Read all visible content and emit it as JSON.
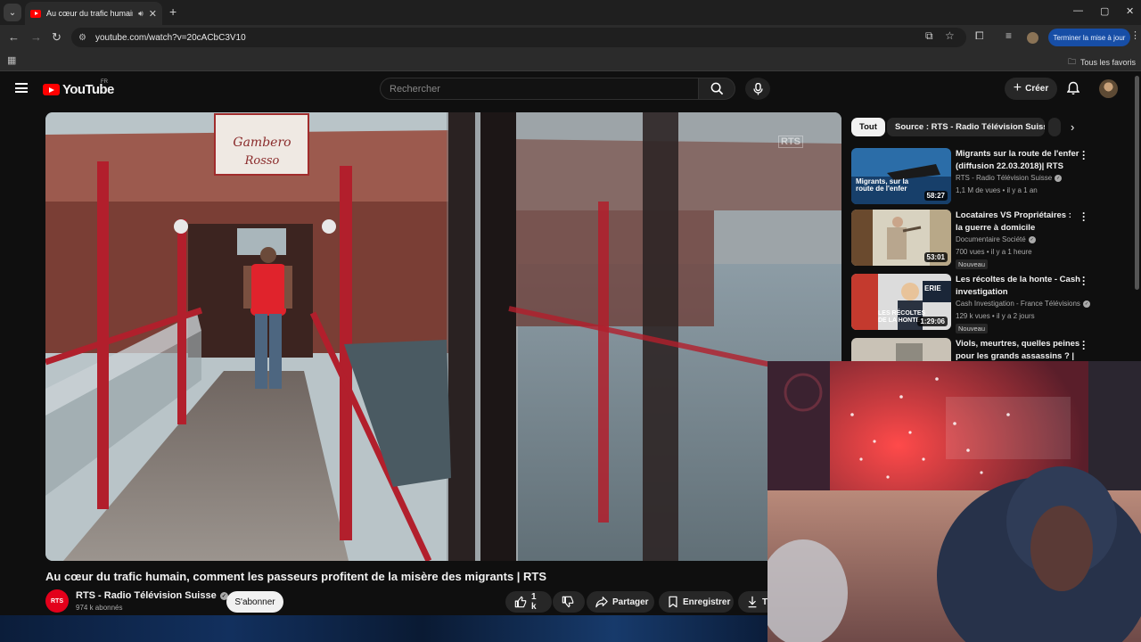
{
  "browser": {
    "tab_title": "Au cœur du trafic humain, comm",
    "url": "youtube.com/watch?v=20cACbC3V10",
    "update_button": "Terminer la mise à jour",
    "all_bookmarks": "Tous les favoris"
  },
  "youtube": {
    "logo_text": "YouTube",
    "region": "FR",
    "search_placeholder": "Rechercher",
    "create_label": "Créer"
  },
  "video": {
    "title": "Au cœur du trafic humain, comment les passeurs profitent de la misère des migrants | RTS",
    "watermark": "RTS",
    "channel_name": "RTS - Radio Télévision Suisse",
    "channel_avatar_text": "RTS",
    "subscribers": "974 k abonnés",
    "subscribe_label": "S'abonner",
    "likes": "1 k",
    "share_label": "Partager",
    "save_label": "Enregistrer",
    "download_label": "Té"
  },
  "sidebar": {
    "chips": [
      "Tout",
      "Source : RTS - Radio Télévision Suisse"
    ],
    "recommendations": [
      {
        "title": "Migrants sur la route de l'enfer (diffusion 22.03.2018)| RTS",
        "channel": "RTS - Radio Télévision Suisse",
        "meta": "1,1 M de vues • il y a 1 an",
        "duration": "58:27",
        "thumb_caption": "Migrants, sur la route de l'enfer",
        "badge": ""
      },
      {
        "title": "Locataires VS Propriétaires : la guerre à domicile",
        "channel": "Documentaire Société",
        "meta": "700 vues • il y a 1 heure",
        "duration": "53:01",
        "badge": "Nouveau"
      },
      {
        "title": "Les récoltes de la honte - Cash investigation",
        "channel": "Cash Investigation - France Télévisions",
        "meta": "129 k vues • il y a 2 jours",
        "duration": "1:29:06",
        "thumb_caption": "LES RÉCOLTES DE LA HONTE",
        "thumb_sign": "ERIE",
        "badge": "Nouveau"
      },
      {
        "title": "Viols, meurtres, quelles peines pour les grands assassins ? | ...",
        "channel": "",
        "meta": "",
        "duration": "",
        "badge": ""
      }
    ]
  },
  "colors": {
    "background": "#0f0f0f",
    "youtube_red": "#ff0000",
    "update_button": "#174ea6"
  }
}
